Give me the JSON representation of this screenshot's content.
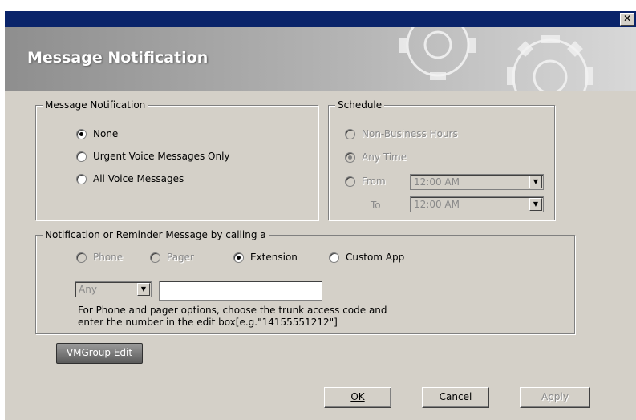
{
  "window": {
    "close_glyph": "✕",
    "banner_title": "Message Notification"
  },
  "message_notification": {
    "legend": "Message Notification",
    "options": [
      {
        "label": "None",
        "checked": true
      },
      {
        "label": "Urgent Voice Messages Only",
        "checked": false
      },
      {
        "label": "All Voice Messages",
        "checked": false
      }
    ]
  },
  "schedule": {
    "legend": "Schedule",
    "options": [
      {
        "label": "Non-Business Hours",
        "checked": false,
        "enabled": false
      },
      {
        "label": "Any Time",
        "checked": true,
        "enabled": false
      },
      {
        "label": "From",
        "checked": false,
        "enabled": false
      }
    ],
    "from_value": "12:00 AM",
    "to_label": "To",
    "to_value": "12:00 AM"
  },
  "notify_by": {
    "legend": "Notification or Reminder Message  by calling a",
    "options": [
      {
        "label": "Phone",
        "checked": false,
        "enabled": false
      },
      {
        "label": "Pager",
        "checked": false,
        "enabled": false
      },
      {
        "label": "Extension",
        "checked": true,
        "enabled": true
      },
      {
        "label": "Custom App",
        "checked": false,
        "enabled": true
      }
    ],
    "trunk_value": "Any",
    "number_value": "",
    "help_line1": "For Phone and pager options, choose the trunk access code and",
    "help_line2": "enter the number in the edit box[e.g.\"14155551212\"]"
  },
  "buttons": {
    "vmgroup_edit": "VMGroup Edit",
    "ok": "OK",
    "cancel": "Cancel",
    "apply": "Apply"
  },
  "colors": {
    "title_bar": "#0a246a",
    "dialog_face": "#d4d0c8"
  }
}
